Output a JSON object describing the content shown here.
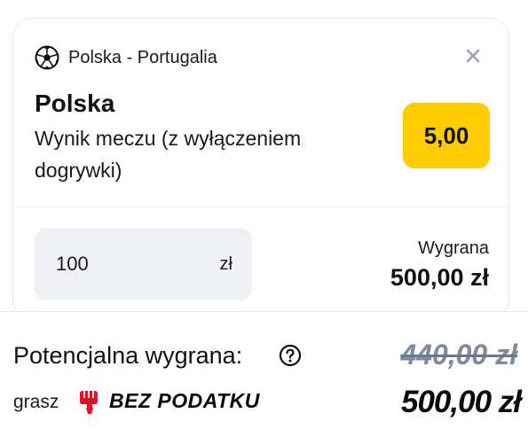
{
  "bet": {
    "match": "Polska - Portugalia",
    "selection": "Polska",
    "market": "Wynik meczu (z wyłączeniem dogrywki)",
    "odds": "5,00",
    "stake": "100",
    "currency": "zł",
    "win_label": "Wygrana",
    "win_value": "500,00 zł"
  },
  "summary": {
    "potential_label": "Potencjalna wygrana:",
    "old_value": "440,00 zł",
    "grasz_label": "grasz",
    "promo_label": "BEZ PODATKU",
    "new_value": "500,00 zł"
  },
  "icons": {
    "sport": "soccer-ball-icon",
    "close": "close-icon",
    "help": "help-icon",
    "promo": "fist-icon"
  },
  "colors": {
    "odds_bg": "#ffcc00",
    "stake_bg": "#eef0f3",
    "promo_icon": "#e3122a",
    "strikethrough": "#7e8b9e"
  }
}
